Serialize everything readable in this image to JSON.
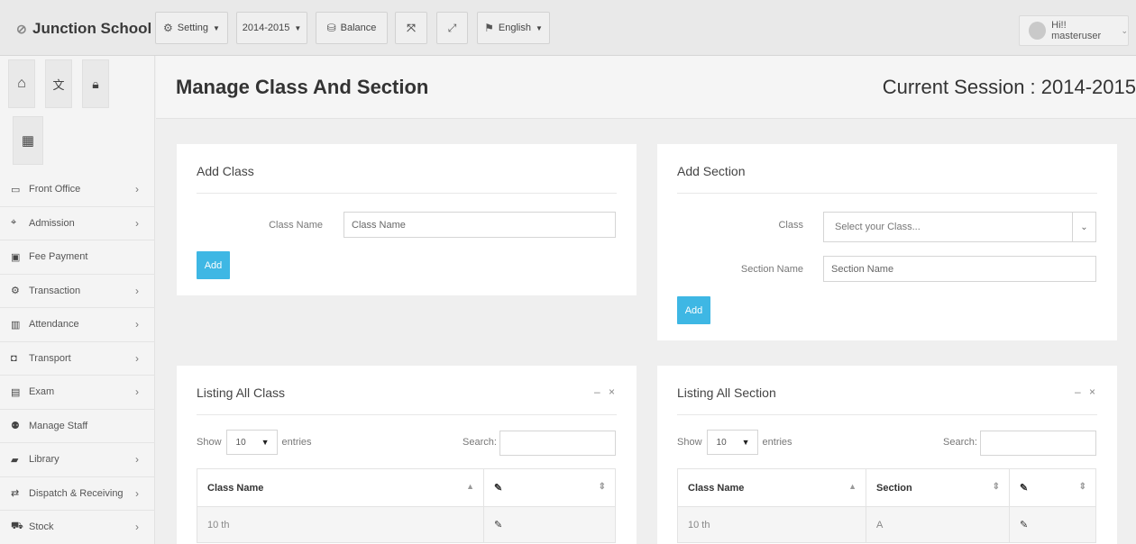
{
  "app": {
    "name": "Junction School"
  },
  "topbar": {
    "setting_label": "Setting",
    "year_label": "2014-2015",
    "balance_label": "Balance",
    "language_label": "English",
    "user_label": "Hi!! masteruser"
  },
  "sidebar": {
    "items": [
      {
        "label": "Front Office",
        "icon": "monitor-icon",
        "has_sub": true
      },
      {
        "label": "Admission",
        "icon": "graduation-cap-icon",
        "has_sub": true
      },
      {
        "label": "Fee Payment",
        "icon": "money-icon",
        "has_sub": false
      },
      {
        "label": "Transaction",
        "icon": "gear-icon",
        "has_sub": true
      },
      {
        "label": "Attendance",
        "icon": "bar-chart-icon",
        "has_sub": true
      },
      {
        "label": "Transport",
        "icon": "bus-icon",
        "has_sub": true
      },
      {
        "label": "Exam",
        "icon": "file-icon",
        "has_sub": true
      },
      {
        "label": "Manage Staff",
        "icon": "users-icon",
        "has_sub": false
      },
      {
        "label": "Library",
        "icon": "book-icon",
        "has_sub": true
      },
      {
        "label": "Dispatch & Receiving",
        "icon": "exchange-icon",
        "has_sub": true
      },
      {
        "label": "Stock",
        "icon": "cart-icon",
        "has_sub": true
      }
    ]
  },
  "page": {
    "title": "Manage Class And Section",
    "session": "Current Session : 2014-2015"
  },
  "add_class": {
    "title": "Add Class",
    "class_name_label": "Class Name",
    "class_name_placeholder": "Class Name",
    "add_label": "Add"
  },
  "add_section": {
    "title": "Add Section",
    "class_label": "Class",
    "class_placeholder": "Select your Class...",
    "section_name_label": "Section Name",
    "section_name_placeholder": "Section Name",
    "add_label": "Add"
  },
  "list_class": {
    "title": "Listing All Class",
    "show_label": "Show",
    "entries_value": "10",
    "entries_label": "entries",
    "search_label": "Search:",
    "columns": [
      "Class Name"
    ],
    "rows": [
      {
        "class_name": "10 th"
      }
    ]
  },
  "list_section": {
    "title": "Listing All Section",
    "show_label": "Show",
    "entries_value": "10",
    "entries_label": "entries",
    "search_label": "Search:",
    "columns": [
      "Class Name",
      "Section"
    ],
    "rows": [
      {
        "class_name": "10 th",
        "section": "A"
      }
    ]
  },
  "panel_controls": {
    "minimize": "–",
    "close": "×"
  }
}
